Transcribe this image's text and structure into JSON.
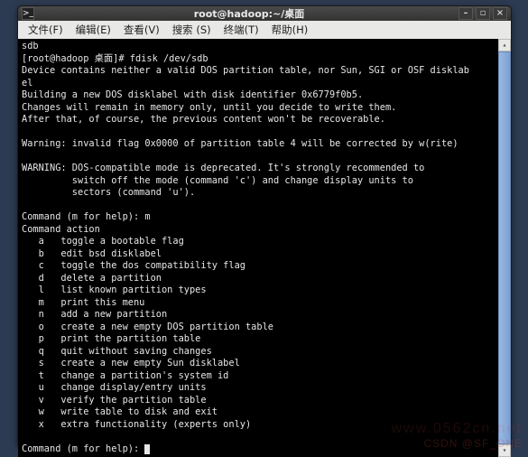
{
  "window": {
    "title": "root@hadoop:~/桌面",
    "icon_glyph": ">_"
  },
  "win_controls": {
    "minimize": "–",
    "maximize": "▫",
    "close": "×"
  },
  "menubar": {
    "items": [
      "文件(F)",
      "编辑(E)",
      "查看(V)",
      "搜索 (S)",
      "终端(T)",
      "帮助(H)"
    ]
  },
  "terminal": {
    "lines": [
      "sdb",
      "[root@hadoop 桌面]# fdisk /dev/sdb",
      "Device contains neither a valid DOS partition table, nor Sun, SGI or OSF disklab",
      "el",
      "Building a new DOS disklabel with disk identifier 0x6779f0b5.",
      "Changes will remain in memory only, until you decide to write them.",
      "After that, of course, the previous content won't be recoverable.",
      "",
      "Warning: invalid flag 0x0000 of partition table 4 will be corrected by w(rite)",
      "",
      "WARNING: DOS-compatible mode is deprecated. It's strongly recommended to",
      "         switch off the mode (command 'c') and change display units to",
      "         sectors (command 'u').",
      "",
      "Command (m for help): m",
      "Command action",
      "   a   toggle a bootable flag",
      "   b   edit bsd disklabel",
      "   c   toggle the dos compatibility flag",
      "   d   delete a partition",
      "   l   list known partition types",
      "   m   print this menu",
      "   n   add a new partition",
      "   o   create a new empty DOS partition table",
      "   p   print the partition table",
      "   q   quit without saving changes",
      "   s   create a new empty Sun disklabel",
      "   t   change a partition's system id",
      "   u   change display/entry units",
      "   v   verify the partition table",
      "   w   write table to disk and exit",
      "   x   extra functionality (experts only)",
      "",
      "Command (m for help): "
    ]
  },
  "scrollbar": {
    "up": "▴",
    "down": "▾"
  },
  "watermark": "CSDN @SF_ONE",
  "watermark2": "www.0562cn.net"
}
